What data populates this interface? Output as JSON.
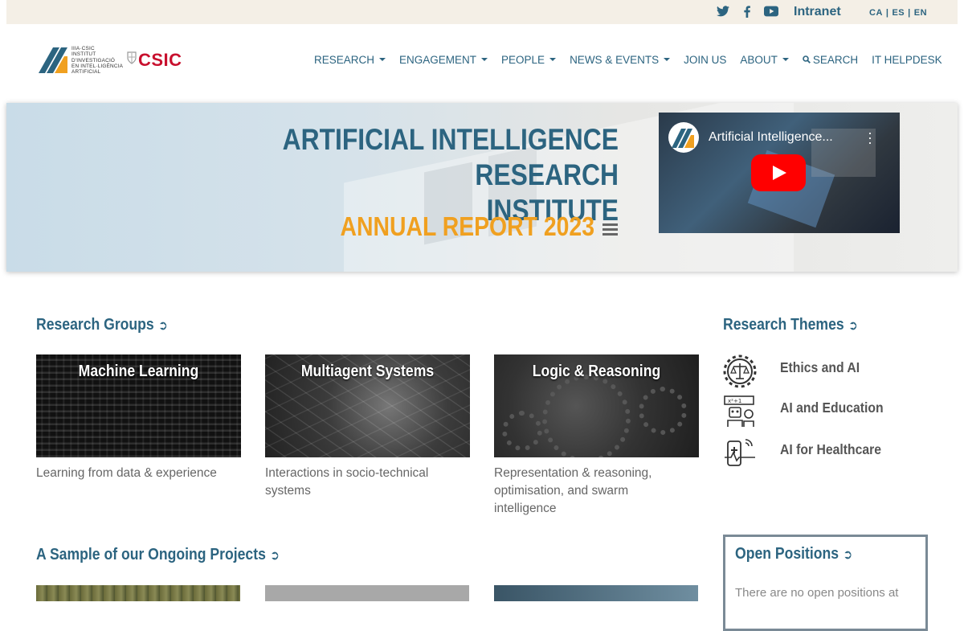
{
  "topbar": {
    "intranet": "Intranet",
    "languages": [
      "CA",
      "ES",
      "EN"
    ],
    "social_icons": [
      "twitter-icon",
      "facebook-icon",
      "youtube-icon"
    ]
  },
  "header": {
    "logo_iiia_lines": [
      "IIIA·CSIC",
      "INSTITUT",
      "D'INVESTIGACIÓ",
      "EN INTEL·LIGÈNCIA",
      "ARTIFICIAL"
    ],
    "logo_csic": "CSIC",
    "nav": [
      {
        "label": "RESEARCH",
        "dropdown": true
      },
      {
        "label": "ENGAGEMENT",
        "dropdown": true
      },
      {
        "label": "PEOPLE",
        "dropdown": true
      },
      {
        "label": "NEWS & EVENTS",
        "dropdown": true
      },
      {
        "label": "JOIN US",
        "dropdown": false
      },
      {
        "label": "ABOUT",
        "dropdown": true
      },
      {
        "label": "SEARCH",
        "dropdown": false
      },
      {
        "label": "IT HELPDESK",
        "dropdown": false
      }
    ]
  },
  "banner": {
    "title_line1": "ARTIFICIAL INTELLIGENCE RESEARCH",
    "title_line2": "INSTITUTE",
    "report": "ANNUAL REPORT 2023",
    "video_title": "Artificial Intelligence..."
  },
  "research_groups": {
    "heading": "Research Groups",
    "items": [
      {
        "title": "Machine Learning",
        "desc": "Learning from data & experience"
      },
      {
        "title": "Multiagent Systems",
        "desc": "Interactions in socio-technical systems"
      },
      {
        "title": "Logic & Reasoning",
        "desc": "Representation & reasoning, optimisation, and swarm intelligence"
      }
    ]
  },
  "research_themes": {
    "heading": "Research Themes",
    "items": [
      {
        "label": "Ethics and AI",
        "icon": "ethics-gear-scale-icon"
      },
      {
        "label": "AI and Education",
        "icon": "education-robot-icon"
      },
      {
        "label": "AI for Healthcare",
        "icon": "healthcare-phone-icon"
      }
    ]
  },
  "projects": {
    "heading": "A Sample of our Ongoing Projects"
  },
  "open_positions": {
    "heading": "Open Positions",
    "text": "There are no open positions at"
  },
  "colors": {
    "brand_blue": "#2c6480",
    "accent_orange": "#f0a020",
    "csic_red": "#c8102e",
    "topbar_bg": "#f4efe6"
  }
}
